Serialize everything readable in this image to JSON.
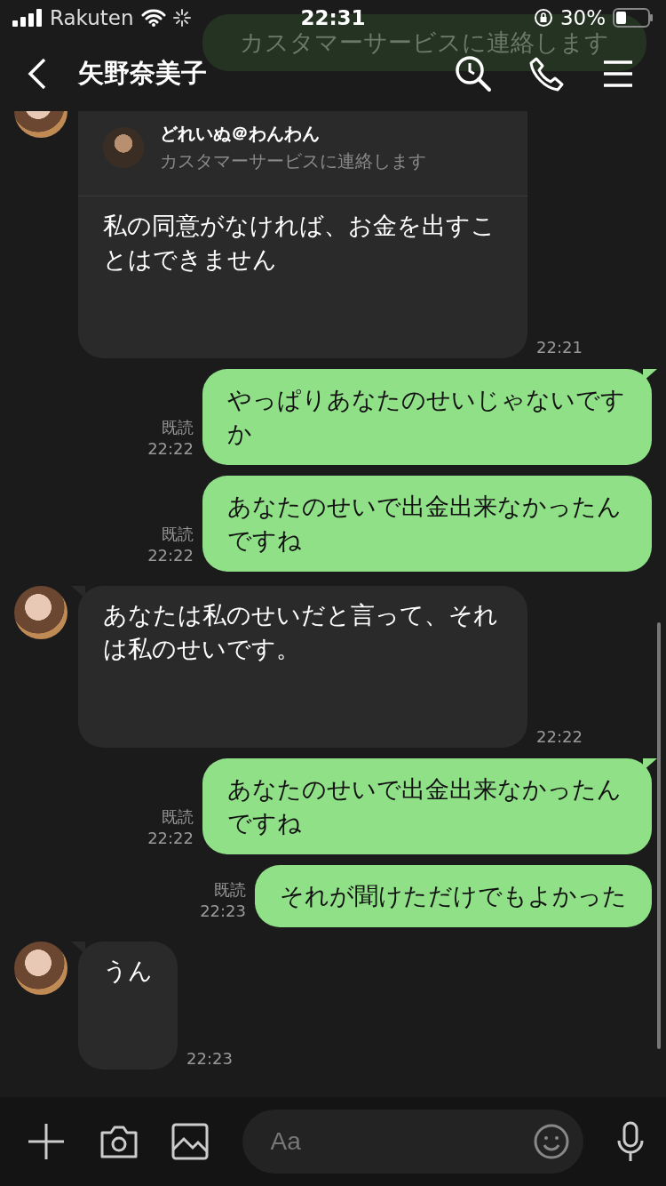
{
  "status_bar": {
    "carrier": "Rakuten",
    "time": "22:31",
    "battery": "30%"
  },
  "header": {
    "title": "矢野奈美子",
    "scrolled_message": "カスタマーサービスに連絡します"
  },
  "messages": [
    {
      "kind": "received",
      "cut_top": true,
      "reply": {
        "name": "どれいぬ＠わんわん",
        "text": "カスタマーサービスに連絡します"
      },
      "text": "私の同意がなければ、お金を出すことはできません",
      "time": "22:21"
    },
    {
      "kind": "sent",
      "tail": true,
      "read": "既読",
      "text": "やっぱりあなたのせいじゃないですか",
      "time": "22:22"
    },
    {
      "kind": "sent",
      "tail": false,
      "read": "既読",
      "text": "あなたのせいで出金出来なかったんですね",
      "time": "22:22"
    },
    {
      "kind": "received",
      "cut_top": false,
      "text": "あなたは私のせいだと言って、それは私のせいです。",
      "time": "22:22"
    },
    {
      "kind": "sent",
      "tail": true,
      "read": "既読",
      "text": "あなたのせいで出金出来なかったんですね",
      "time": "22:22"
    },
    {
      "kind": "sent",
      "tail": false,
      "read": "既読",
      "text": "それが聞けただけでもよかった",
      "time": "22:23"
    },
    {
      "kind": "received",
      "cut_top": false,
      "text": "うん",
      "time": "22:23"
    }
  ],
  "composer": {
    "placeholder": "Aa"
  }
}
